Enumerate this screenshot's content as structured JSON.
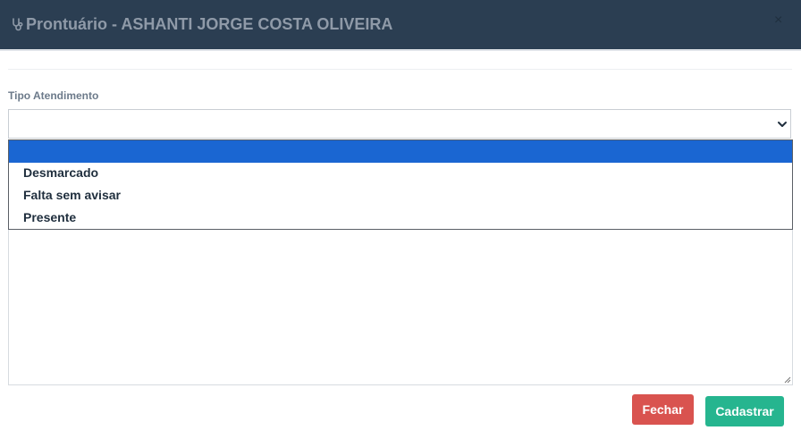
{
  "modal": {
    "title": "Prontuário - ASHANTI JORGE COSTA OLIVEIRA",
    "close_symbol": "×",
    "title_icon": "stethoscope-icon"
  },
  "form": {
    "tipo_atendimento_label": "Tipo Atendimento",
    "selected_value": "",
    "options": [
      "",
      "Desmarcado",
      "Falta sem avisar",
      "Presente"
    ]
  },
  "buttons": {
    "fechar_label": "Fechar",
    "cadastrar_label": "Cadastrar"
  },
  "colors": {
    "header_bg": "#2b3e52",
    "header_text": "#8f9aa8",
    "option_highlight": "#1a66d2",
    "fechar_bg": "#d9534f",
    "cadastrar_bg": "#26b58f"
  }
}
